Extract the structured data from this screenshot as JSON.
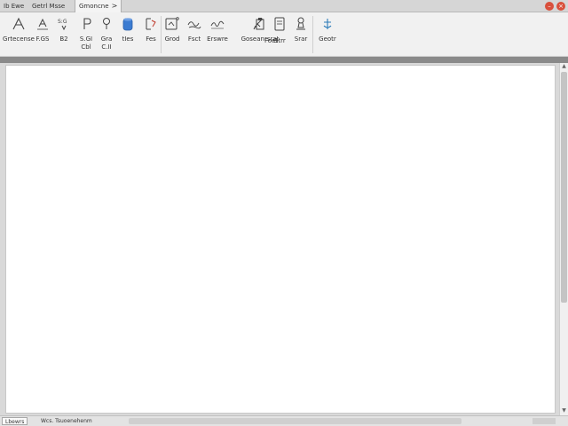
{
  "tabs": [
    {
      "label": "Ib Ewe"
    },
    {
      "label": "Getrl Msse"
    },
    {
      "label": "Gmoncne"
    }
  ],
  "tab_chevron": ">",
  "window_buttons": {
    "minimize": "–",
    "close": "×"
  },
  "toolbar": [
    {
      "label": "Grtecense",
      "icon": "pen-tool-icon"
    },
    {
      "label": "F.GS",
      "icon": "text-a-icon"
    },
    {
      "label": "B2",
      "icon": "font-size-icon"
    },
    {
      "label": "S.GI",
      "sublabel": "Cbl",
      "icon": "paragraph-icon"
    },
    {
      "label": "Gra",
      "sublabel": "C.II",
      "icon": "pin-icon"
    },
    {
      "label": "tIes",
      "icon": "cylinder-icon"
    },
    {
      "label": "Fes",
      "icon": "bracket-icon"
    },
    {
      "label": "Grod",
      "icon": "frame-icon"
    },
    {
      "label": "Fsct",
      "icon": "scribble-icon"
    },
    {
      "label": "Erswre",
      "icon": "signature-icon"
    },
    {
      "label": "Goseanrsrat",
      "icon": "clipboard-icon"
    },
    {
      "label": "Foet",
      "icon": "brush-icon"
    },
    {
      "label": "Gtrr",
      "icon": "notebook-icon"
    },
    {
      "label": "Srar",
      "icon": "stamp-icon"
    },
    {
      "label": "Geotr",
      "icon": "anchor-icon"
    }
  ],
  "scroll_arrows": {
    "up": "▲",
    "down": "▼"
  },
  "status": {
    "page": "Lbewrs",
    "text": "Wcs. Tsuoenehenm"
  },
  "colors": {
    "accent_blue": "#3b7bd1",
    "close_red": "#d9503c"
  }
}
